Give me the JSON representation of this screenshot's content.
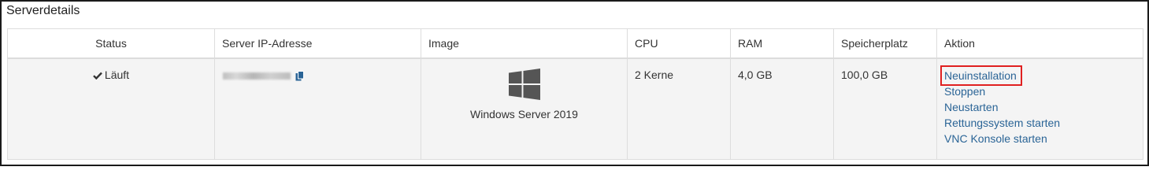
{
  "panel": {
    "title": "Serverdetails"
  },
  "table": {
    "headers": [
      "Status",
      "Server IP-Adresse",
      "Image",
      "CPU",
      "RAM",
      "Speicherplatz",
      "Aktion"
    ],
    "row": {
      "status": "Läuft",
      "ip_address_icon": "copy-icon",
      "image": {
        "icon": "windows-logo-icon",
        "name": "Windows Server 2019"
      },
      "cpu": "2 Kerne",
      "ram": "4,0 GB",
      "storage": "100,0 GB",
      "actions": [
        "Neuinstallation",
        "Stoppen",
        "Neustarten",
        "Rettungssystem starten",
        "VNC Konsole starten"
      ]
    }
  },
  "colors": {
    "link": "#2a6496",
    "highlight_border": "#e02020",
    "row_background": "#f4f4f4",
    "windows_logo": "#555555"
  }
}
